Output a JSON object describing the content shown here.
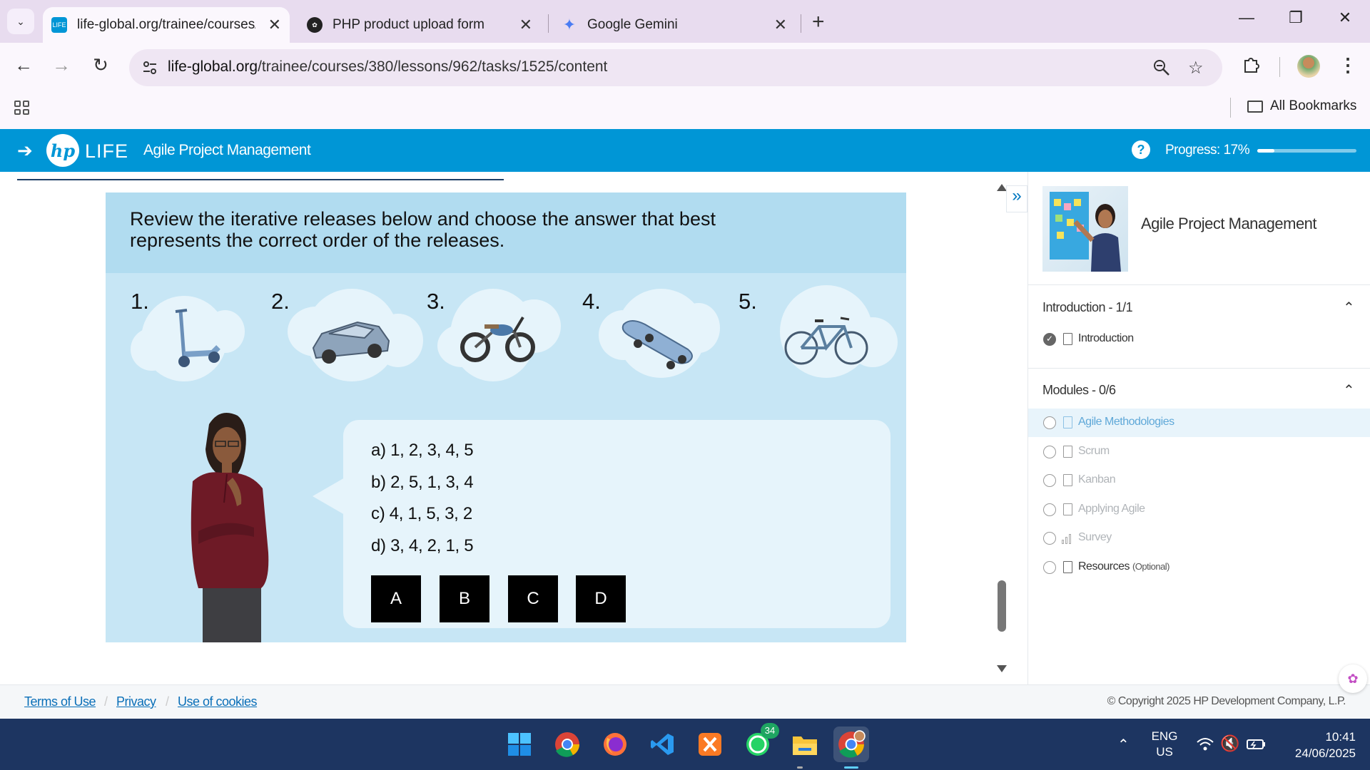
{
  "browser": {
    "tabs": [
      {
        "title": "life-global.org/trainee/courses/",
        "active": true
      },
      {
        "title": "PHP product upload form",
        "active": false
      },
      {
        "title": "Google Gemini",
        "active": false
      }
    ],
    "url_domain": "life-global.org",
    "url_path": "/trainee/courses/380/lessons/962/tasks/1525/content",
    "all_bookmarks": "All Bookmarks"
  },
  "header": {
    "brand": "LIFE",
    "hp": "hp",
    "course_title": "Agile Project Management",
    "help": "?",
    "progress_label": "Progress: 17%",
    "progress_value": 0.17
  },
  "task": {
    "question": "Review the iterative releases below and choose the answer that best represents the correct order of the releases.",
    "releases": [
      {
        "num": "1.",
        "icon": "scooter"
      },
      {
        "num": "2.",
        "icon": "car"
      },
      {
        "num": "3.",
        "icon": "motorcycle"
      },
      {
        "num": "4.",
        "icon": "skateboard"
      },
      {
        "num": "5.",
        "icon": "bicycle"
      }
    ],
    "options": [
      "a) 1, 2, 3, 4, 5",
      "b) 2, 5, 1, 3, 4",
      "c) 4, 1, 5, 3, 2",
      "d) 3, 4, 2, 1, 5"
    ],
    "buttons": [
      "A",
      "B",
      "C",
      "D"
    ]
  },
  "sidebar": {
    "title": "Agile Project Management",
    "intro_section": "Introduction - 1/1",
    "intro_items": [
      {
        "label": "Introduction",
        "done": true
      }
    ],
    "modules_section": "Modules - 0/6",
    "modules": [
      {
        "label": "Agile Methodologies",
        "icon": "document"
      },
      {
        "label": "Scrum",
        "icon": "document"
      },
      {
        "label": "Kanban",
        "icon": "document"
      },
      {
        "label": "Applying Agile",
        "icon": "document"
      },
      {
        "label": "Survey",
        "icon": "bar-chart"
      },
      {
        "label": "Resources",
        "optional": "(Optional)",
        "icon": "document"
      }
    ]
  },
  "footer": {
    "links": [
      "Terms of Use",
      "Privacy",
      "Use of cookies"
    ],
    "copyright": "© Copyright 2025 HP Development Company, L.P."
  },
  "taskbar": {
    "whatsapp_badge": "34",
    "lang_top": "ENG",
    "lang_bottom": "US",
    "time": "10:41",
    "date": "24/06/2025"
  },
  "colors": {
    "brand_blue": "#0096d6",
    "task_bg": "#c7e6f5",
    "taskbar": "#1d3561"
  }
}
